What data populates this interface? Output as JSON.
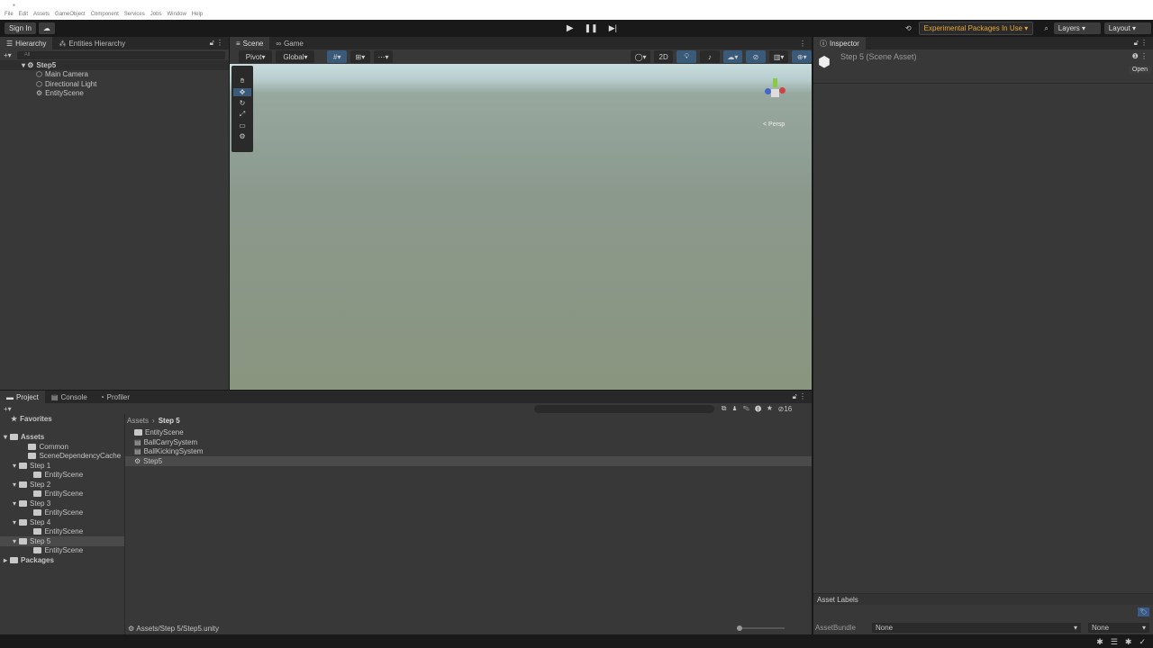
{
  "window": {
    "menu": [
      "File",
      "Edit",
      "Assets",
      "GameObject",
      "Component",
      "Services",
      "Jobs",
      "Window",
      "Help"
    ]
  },
  "toolbar": {
    "sign_in": "Sign In",
    "experimental": "Experimental Packages In Use",
    "layers": "Layers",
    "layout": "Layout"
  },
  "hierarchy": {
    "tabs": [
      "Hierarchy",
      "Entities Hierarchy"
    ],
    "search_placeholder": "All",
    "scene": "Step5",
    "items": [
      "Main Camera",
      "Directional Light",
      "EntityScene"
    ]
  },
  "scene": {
    "tabs": [
      "Scene",
      "Game"
    ],
    "pivot": "Pivot",
    "global": "Global",
    "mode_2d": "2D",
    "persp": "< Persp"
  },
  "inspector": {
    "tab": "Inspector",
    "title": "Step 5 (Scene Asset)",
    "open": "Open",
    "asset_labels": "Asset Labels",
    "asset_bundle_label": "AssetBundle",
    "asset_bundle": "None",
    "variant": "None"
  },
  "project": {
    "tabs": [
      "Project",
      "Console",
      "Profiler"
    ],
    "favorites": "Favorites",
    "assets": "Assets",
    "tree": [
      {
        "label": "Common",
        "depth": 1
      },
      {
        "label": "SceneDependencyCache",
        "depth": 1
      },
      {
        "label": "Step 1",
        "depth": 1
      },
      {
        "label": "EntityScene",
        "depth": 2
      },
      {
        "label": "Step 2",
        "depth": 1
      },
      {
        "label": "EntityScene",
        "depth": 2
      },
      {
        "label": "Step 3",
        "depth": 1
      },
      {
        "label": "EntityScene",
        "depth": 2
      },
      {
        "label": "Step 4",
        "depth": 1
      },
      {
        "label": "EntityScene",
        "depth": 2
      },
      {
        "label": "Step 5",
        "depth": 1
      },
      {
        "label": "EntityScene",
        "depth": 2
      }
    ],
    "packages": "Packages",
    "breadcrumb": [
      "Assets",
      "Step 5"
    ],
    "files": [
      {
        "label": "EntityScene",
        "type": "folder"
      },
      {
        "label": "BallCarrySystem",
        "type": "script"
      },
      {
        "label": "BallKickingSystem",
        "type": "script"
      },
      {
        "label": "Step5",
        "type": "scene"
      }
    ],
    "hidden_count": "16",
    "path": "Assets/Step 5/Step5.unity"
  }
}
